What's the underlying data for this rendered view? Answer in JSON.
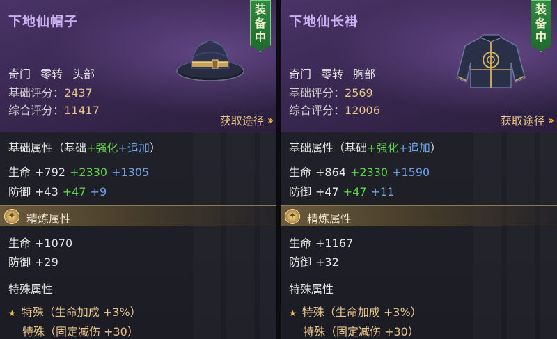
{
  "panels": [
    {
      "name": "下地仙帽子",
      "equip_tag": [
        "装",
        "备",
        "中"
      ],
      "type": [
        "奇门",
        "零转",
        "头部"
      ],
      "base_score_label": "基础评分：",
      "base_score": "2437",
      "total_score_label": "综合评分：",
      "total_score": "11417",
      "obtain_label": "获取途径",
      "icon": "hat-icon",
      "attr_title": "基础属性",
      "attr_title_paren_open": "（基础",
      "attr_title_plus1": "+强化",
      "attr_title_plus2": "+追加",
      "attr_title_paren_close": "）",
      "attrs": [
        {
          "name": "生命",
          "base": "+792",
          "enhance": "+2330",
          "extra": "+1305"
        },
        {
          "name": "防御",
          "base": "+43",
          "enhance": "+47",
          "extra": "+9"
        }
      ],
      "refine_title": "精炼属性",
      "refine": [
        {
          "name": "生命",
          "value": "+1070"
        },
        {
          "name": "防御",
          "value": "+29"
        }
      ],
      "special_title": "特殊属性",
      "specials": [
        "特殊（生命加成 +3%）",
        "特殊（固定减伤 +30）"
      ]
    },
    {
      "name": "下地仙长褂",
      "equip_tag": [
        "装",
        "备",
        "中"
      ],
      "type": [
        "奇门",
        "零转",
        "胸部"
      ],
      "base_score_label": "基础评分：",
      "base_score": "2569",
      "total_score_label": "综合评分：",
      "total_score": "12006",
      "obtain_label": "获取途径",
      "icon": "robe-icon",
      "attr_title": "基础属性",
      "attr_title_paren_open": "（基础",
      "attr_title_plus1": "+强化",
      "attr_title_plus2": "+追加",
      "attr_title_paren_close": "）",
      "attrs": [
        {
          "name": "生命",
          "base": "+864",
          "enhance": "+2330",
          "extra": "+1590"
        },
        {
          "name": "防御",
          "base": "+47",
          "enhance": "+47",
          "extra": "+11"
        }
      ],
      "refine_title": "精炼属性",
      "refine": [
        {
          "name": "生命",
          "value": "+1167"
        },
        {
          "name": "防御",
          "value": "+32"
        }
      ],
      "special_title": "特殊属性",
      "specials": [
        "特殊（生命加成 +3%）",
        "特殊（固定减伤 +30）"
      ]
    }
  ]
}
